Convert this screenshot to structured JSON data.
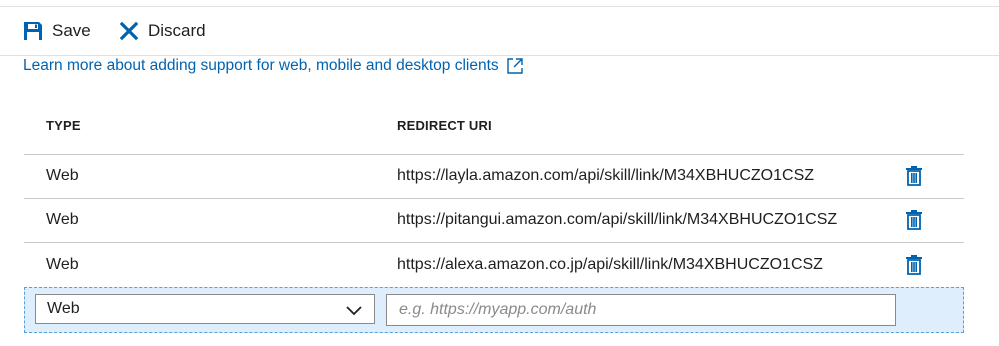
{
  "toolbar": {
    "save_label": "Save",
    "discard_label": "Discard",
    "save_icon": "save-icon",
    "discard_icon": "close-icon"
  },
  "learn_more": {
    "text": "Learn more about adding support for web, mobile and desktop clients",
    "icon": "external-link-icon"
  },
  "table": {
    "headers": {
      "type": "TYPE",
      "redirect_uri": "REDIRECT URI"
    },
    "rows": [
      {
        "type": "Web",
        "uri": "https://layla.amazon.com/api/skill/link/M34XBHUCZO1CSZ"
      },
      {
        "type": "Web",
        "uri": "https://pitangui.amazon.com/api/skill/link/M34XBHUCZO1CSZ"
      },
      {
        "type": "Web",
        "uri": "https://alexa.amazon.co.jp/api/skill/link/M34XBHUCZO1CSZ"
      }
    ],
    "new_row": {
      "type_value": "Web",
      "uri_placeholder": "e.g. https://myapp.com/auth",
      "uri_value": ""
    }
  },
  "colors": {
    "accent": "#0063b1",
    "new_row_bg": "#dfeefc",
    "new_row_border": "#5aa0d8"
  }
}
